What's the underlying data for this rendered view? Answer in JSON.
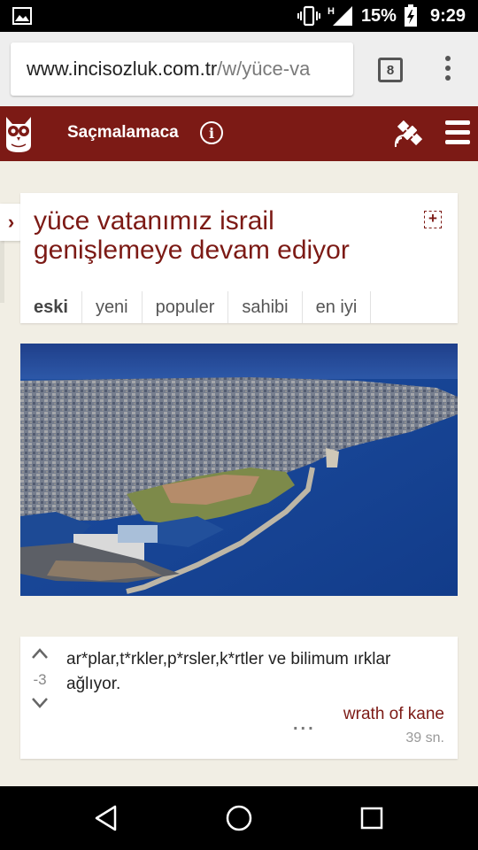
{
  "status_bar": {
    "battery_percent": "15%",
    "time": "9:29",
    "network": "H",
    "icons": [
      "image-notification-icon",
      "vibrate-icon",
      "signal-icon",
      "battery-charging-icon"
    ]
  },
  "browser": {
    "url_host": "www.incisozluk.com.tr",
    "url_path": "/w/yüce-va",
    "tab_count": "8",
    "menu_icon": "overflow-menu-icon"
  },
  "site_header": {
    "logo_icon": "owl-logo-icon",
    "title": "Saçmalamaca",
    "info_icon": "info-icon",
    "satellite_icon": "satellite-icon",
    "menu_icon": "hamburger-menu-icon",
    "color": "#7c1a15"
  },
  "topic": {
    "title": "yüce vatanımız israil genişlemeye devam ediyor",
    "add_icon": "+",
    "side_arrow": "›",
    "sort_tabs": [
      {
        "label": "eski",
        "active": true
      },
      {
        "label": "yeni",
        "active": false
      },
      {
        "label": "populer",
        "active": false
      },
      {
        "label": "sahibi",
        "active": false
      },
      {
        "label": "en iyi",
        "active": false
      }
    ]
  },
  "image": {
    "description_icon": "aerial-city-photo"
  },
  "entry": {
    "vote_count": "-3",
    "text": "ar*plar,t*rkler,p*rsler,k*rtler ve bilimum ırklar ağlıyor.",
    "more": "...",
    "author": "wrath of kane",
    "time": "39 sn."
  },
  "nav_bar": {
    "icons": [
      "back-icon",
      "home-icon",
      "recents-icon"
    ]
  }
}
